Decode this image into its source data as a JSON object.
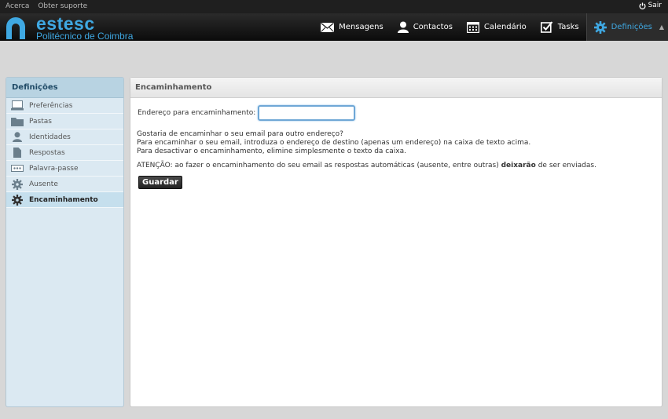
{
  "topbar": {
    "about": "Acerca",
    "support": "Obter suporte",
    "logout": "Sair"
  },
  "logo": {
    "name": "estesc",
    "subtitle": "Politécnico de Coimbra"
  },
  "nav": {
    "messages": "Mensagens",
    "contacts": "Contactos",
    "calendar": "Calendário",
    "tasks": "Tasks",
    "settings": "Definições"
  },
  "sidebar": {
    "title": "Definições",
    "items": [
      {
        "label": "Preferências",
        "icon": "monitor-icon"
      },
      {
        "label": "Pastas",
        "icon": "folder-icon"
      },
      {
        "label": "Identidades",
        "icon": "user-icon"
      },
      {
        "label": "Respostas",
        "icon": "document-icon"
      },
      {
        "label": "Palavra-passe",
        "icon": "password-icon"
      },
      {
        "label": "Ausente",
        "icon": "gear-icon"
      },
      {
        "label": "Encaminhamento",
        "icon": "gear-icon",
        "active": true
      }
    ]
  },
  "main": {
    "title": "Encaminhamento",
    "field_label": "Endereço para encaminhamento:",
    "field_value": "",
    "info_line1": "Gostaria de encaminhar o seu email para outro endereço?",
    "info_line2": "Para encaminhar o seu email, introduza o endereço de destino (apenas um endereço) na caixa de texto acima.",
    "info_line3": "Para desactivar o encaminhamento, elimine simplesmente o texto da caixa.",
    "warn_prefix": "ATENÇÃO: ao fazer o encaminhamento do seu email as respostas automáticas (ausente, entre outras)",
    "warn_bold": "deixarão",
    "warn_suffix": "de ser enviadas.",
    "save_label": "Guardar"
  },
  "colors": {
    "accent": "#3fa8e2",
    "header_bg": "#0b0b0b",
    "sidebar_bg": "#dbe9f2"
  }
}
